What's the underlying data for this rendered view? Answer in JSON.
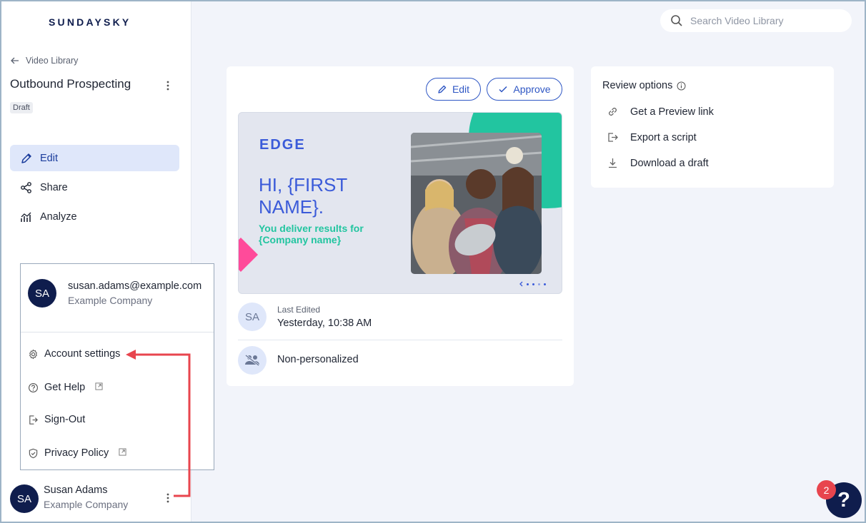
{
  "app": {
    "logo": "SUNDAYSKY"
  },
  "sidebar": {
    "back_label": "Video Library",
    "project_title": "Outbound Prospecting",
    "status_badge": "Draft",
    "nav": [
      {
        "label": "Edit",
        "icon": "pencil-icon",
        "active": true
      },
      {
        "label": "Share",
        "icon": "share-icon",
        "active": false
      },
      {
        "label": "Analyze",
        "icon": "analytics-icon",
        "active": false
      }
    ]
  },
  "user_menu": {
    "initials": "SA",
    "email": "susan.adams@example.com",
    "company": "Example Company",
    "items": [
      {
        "label": "Account settings",
        "icon": "gear-icon"
      },
      {
        "label": "Get Help",
        "icon": "question-circle-icon",
        "external": true
      },
      {
        "label": "Sign-Out",
        "icon": "sign-out-icon"
      },
      {
        "label": "Privacy Policy",
        "icon": "shield-icon",
        "external": true
      }
    ]
  },
  "user": {
    "initials": "SA",
    "name": "Susan Adams",
    "company": "Example Company"
  },
  "search": {
    "placeholder": "Search Video Library"
  },
  "video_card": {
    "edit_label": "Edit",
    "approve_label": "Approve",
    "preview": {
      "brand": "EDGE",
      "headline": "HI, {FIRST NAME}.",
      "subline": "You deliver results for {Company name}"
    },
    "last_edited_initials": "SA",
    "last_edited_label": "Last Edited",
    "last_edited_value": "Yesterday, 10:38 AM",
    "personalization": "Non-personalized"
  },
  "review": {
    "title": "Review options",
    "items": [
      {
        "label": "Get a Preview link",
        "icon": "link-icon"
      },
      {
        "label": "Export a script",
        "icon": "export-icon"
      },
      {
        "label": "Download a draft",
        "icon": "download-icon"
      }
    ]
  },
  "help": {
    "symbol": "?",
    "badge": "2"
  },
  "colors": {
    "accent": "#2f57c4",
    "navy": "#0f1d4d",
    "teal": "#22c5a0",
    "pink": "#ff4b9a",
    "annotation": "#e8454e"
  }
}
